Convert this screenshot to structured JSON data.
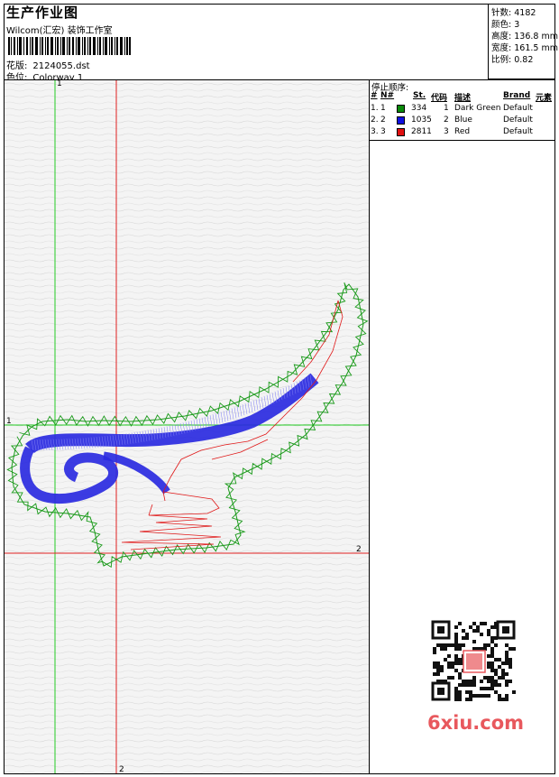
{
  "header": {
    "title": "生产作业图",
    "subtitle": "Wilcom(汇宏) 装饰工作室",
    "design_label": "花版:",
    "design_value": "2124055.dst",
    "colorway_label": "色位:",
    "colorway_value": "Colorway 1"
  },
  "stats": {
    "stitches_label": "针数:",
    "stitches_value": "4182",
    "colors_label": "颜色:",
    "colors_value": "3",
    "height_label": "高度:",
    "height_value": "136.8 mm",
    "width_label": "宽度:",
    "width_value": "161.5 mm",
    "scale_label": "比例:",
    "scale_value": "0.82"
  },
  "stop_sequence": {
    "title": "停止顺序:",
    "headers": [
      "#",
      "N#",
      "St.",
      "代码",
      "描述",
      "Brand",
      "元素"
    ],
    "rows": [
      {
        "idx": "1.",
        "n": "1",
        "st": "334",
        "code": "1",
        "desc": "Dark Green",
        "brand": "Default",
        "color": "#0a8a0a"
      },
      {
        "idx": "2.",
        "n": "2",
        "st": "1035",
        "code": "2",
        "desc": "Blue",
        "brand": "Default",
        "color": "#1010e0"
      },
      {
        "idx": "3.",
        "n": "3",
        "st": "2811",
        "code": "3",
        "desc": "Red",
        "brand": "Default",
        "color": "#e01010"
      }
    ]
  },
  "axes": {
    "green_top": "1",
    "green_left": "1",
    "red_right": "2",
    "red_bottom": "2"
  },
  "watermark": {
    "site": "6xiu.com"
  }
}
